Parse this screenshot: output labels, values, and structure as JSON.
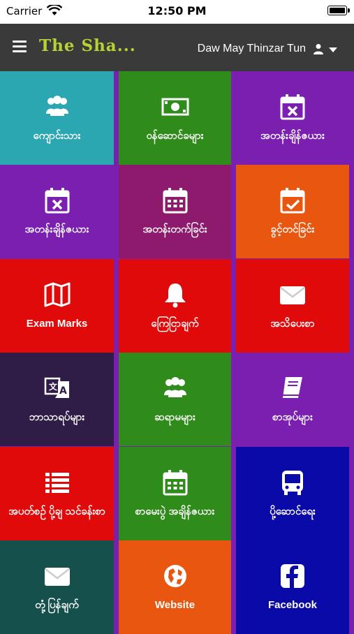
{
  "status_bar": {
    "carrier": "Carrier",
    "time": "12:50 PM"
  },
  "header": {
    "title": "The Sha...",
    "user_name": "Daw May Thinzar Tun"
  },
  "tiles": [
    {
      "label": "ကျောင်းသား",
      "icon": "users-icon",
      "color": "#2aa7b1"
    },
    {
      "label": "ဝန်ဆောင်ခများ",
      "icon": "money-bill-icon",
      "color": "#2f8c1a"
    },
    {
      "label": "အတန်းချိန်ဇယား",
      "icon": "calendar-x-icon",
      "color": "#7b1fb0"
    },
    {
      "label": "အတန်းချိန်ဇယား",
      "icon": "calendar-x-icon",
      "color": "#7b1fb0"
    },
    {
      "label": "အတန်းတက်ခြင်း",
      "icon": "calendar-grid-icon",
      "color": "#8e1a6e"
    },
    {
      "label": "ခွင့်တင်ခြင်း",
      "icon": "calendar-check-icon",
      "color": "#e8560f"
    },
    {
      "label": "Exam Marks",
      "icon": "map-icon",
      "color": "#e10a0a"
    },
    {
      "label": "ကြေငြာချက်",
      "icon": "bell-icon",
      "color": "#e10a0a"
    },
    {
      "label": "အသိပေးစာ",
      "icon": "envelope-icon",
      "color": "#e10a0a"
    },
    {
      "label": "ဘာသာရပ်များ",
      "icon": "translate-icon",
      "color": "#2f1d47"
    },
    {
      "label": "ဆရာမများ",
      "icon": "users-icon",
      "color": "#2f8c1a"
    },
    {
      "label": "စာအုပ်များ",
      "icon": "book-icon",
      "color": "#7b1fb0"
    },
    {
      "label": "အပတ်စဉ် ပို့ချ သင်ခန်းစာ",
      "icon": "list-icon",
      "color": "#e10a0a"
    },
    {
      "label": "စာမေးပွဲ အချိန်ဇယား",
      "icon": "calendar-grid-icon",
      "color": "#2f8c1a"
    },
    {
      "label": "ပို့ဆောင်ရေး",
      "icon": "bus-icon",
      "color": "#0a0aa8"
    },
    {
      "label": "တုံ့ပြန်ချက်",
      "icon": "envelope-icon",
      "color": "#15504d"
    },
    {
      "label": "Website",
      "icon": "globe-icon",
      "color": "#e8560f"
    },
    {
      "label": "Facebook",
      "icon": "facebook-icon",
      "color": "#0a0aa8"
    }
  ]
}
